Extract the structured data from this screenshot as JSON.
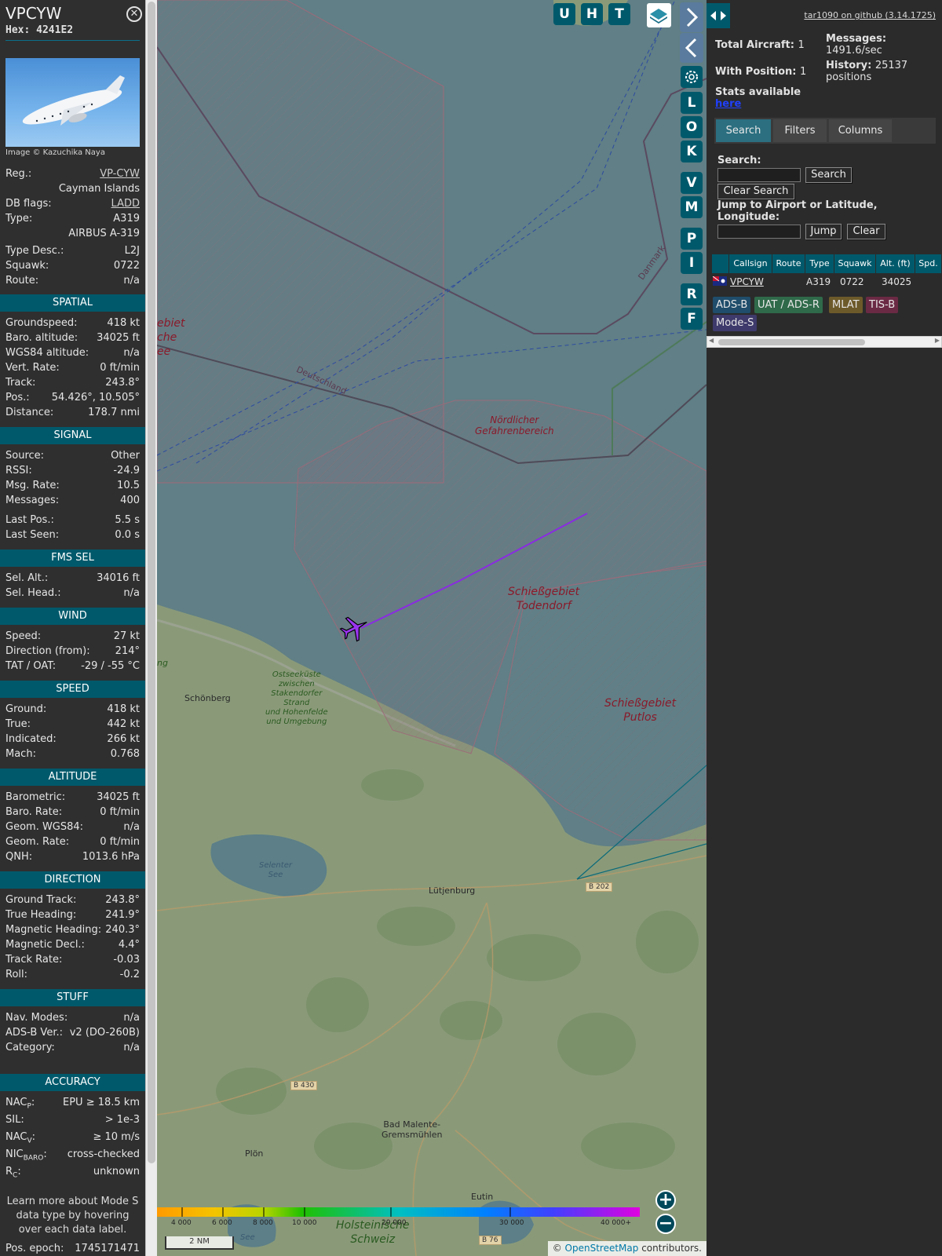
{
  "aircraft": {
    "callsign": "VPCYW",
    "hex_label": "Hex:",
    "hex": "4241E2",
    "photo_credit": "Image © Kazuchika Naya",
    "rows": [
      {
        "k": "Reg.:",
        "v": "VP-CYW",
        "link": true
      },
      {
        "k": "",
        "v": "Cayman Islands"
      },
      {
        "k": "DB flags:",
        "v": "LADD",
        "link": true
      },
      {
        "k": "Type:",
        "v": "A319"
      },
      {
        "k": "",
        "v": "AIRBUS A-319"
      },
      {
        "k": "Type Desc.:",
        "v": "L2J"
      },
      {
        "k": "Squawk:",
        "v": "0722"
      },
      {
        "k": "Route:",
        "v": "n/a"
      }
    ]
  },
  "sections": {
    "spatial": {
      "title": "SPATIAL",
      "rows": [
        {
          "k": "Groundspeed:",
          "v": "418 kt"
        },
        {
          "k": "Baro. altitude:",
          "v": "34025 ft"
        },
        {
          "k": "WGS84 altitude:",
          "v": "n/a"
        },
        {
          "k": "Vert. Rate:",
          "v": "0 ft/min"
        },
        {
          "k": "Track:",
          "v": "243.8°"
        },
        {
          "k": "Pos.:",
          "v": "54.426°, 10.505°"
        },
        {
          "k": "Distance:",
          "v": "178.7 nmi"
        }
      ]
    },
    "signal": {
      "title": "SIGNAL",
      "rows": [
        {
          "k": "Source:",
          "v": "Other"
        },
        {
          "k": "RSSI:",
          "v": "-24.9"
        },
        {
          "k": "Msg. Rate:",
          "v": "10.5"
        },
        {
          "k": "Messages:",
          "v": "400"
        },
        {
          "k": "Last Pos.:",
          "v": "5.5 s"
        },
        {
          "k": "Last Seen:",
          "v": "0.0 s"
        }
      ]
    },
    "fms": {
      "title": "FMS SEL",
      "rows": [
        {
          "k": "Sel. Alt.:",
          "v": "34016 ft"
        },
        {
          "k": "Sel. Head.:",
          "v": "n/a"
        }
      ]
    },
    "wind": {
      "title": "WIND",
      "rows": [
        {
          "k": "Speed:",
          "v": "27 kt"
        },
        {
          "k": "Direction (from):",
          "v": "214°"
        },
        {
          "k": "TAT / OAT:",
          "v": "-29 / -55 °C"
        }
      ]
    },
    "speed": {
      "title": "SPEED",
      "rows": [
        {
          "k": "Ground:",
          "v": "418 kt"
        },
        {
          "k": "True:",
          "v": "442 kt"
        },
        {
          "k": "Indicated:",
          "v": "266 kt"
        },
        {
          "k": "Mach:",
          "v": "0.768"
        }
      ]
    },
    "altitude": {
      "title": "ALTITUDE",
      "rows": [
        {
          "k": "Barometric:",
          "v": "34025 ft"
        },
        {
          "k": "Baro. Rate:",
          "v": "0 ft/min"
        },
        {
          "k": "Geom. WGS84:",
          "v": "n/a"
        },
        {
          "k": "Geom. Rate:",
          "v": "0 ft/min"
        },
        {
          "k": "QNH:",
          "v": "1013.6 hPa"
        }
      ]
    },
    "direction": {
      "title": "DIRECTION",
      "rows": [
        {
          "k": "Ground Track:",
          "v": "243.8°"
        },
        {
          "k": "True Heading:",
          "v": "241.9°"
        },
        {
          "k": "Magnetic Heading:",
          "v": "240.3°"
        },
        {
          "k": "Magnetic Decl.:",
          "v": "4.4°"
        },
        {
          "k": "Track Rate:",
          "v": "-0.03"
        },
        {
          "k": "Roll:",
          "v": "-0.2"
        }
      ]
    },
    "stuff": {
      "title": "STUFF",
      "rows": [
        {
          "k": "Nav. Modes:",
          "v": "n/a"
        },
        {
          "k": "ADS-B Ver.:",
          "v": "v2 (DO-260B)"
        },
        {
          "k": "Category:",
          "v": "n/a"
        }
      ]
    },
    "accuracy": {
      "title": "ACCURACY",
      "rows": [
        {
          "k": "NAC",
          "sub": "P",
          "v": "EPU ≥ 18.5 km"
        },
        {
          "k": "SIL:",
          "v": "> 1e-3"
        },
        {
          "k": "NAC",
          "sub": "V",
          "v": "≥ 10 m/s"
        },
        {
          "k": "NIC",
          "sub": "BARO",
          "v": "cross-checked"
        },
        {
          "k": "R",
          "sub": "C",
          "v": "unknown"
        }
      ]
    }
  },
  "footer_note": "Learn more about Mode S data type by hovering over each data label.",
  "pos_epoch": {
    "k": "Pos. epoch:",
    "v": "1745171471"
  },
  "map": {
    "buttons": [
      "U",
      "H",
      "T"
    ],
    "side_buttons": [
      "L",
      "O",
      "K",
      "V",
      "M",
      "P",
      "I",
      "R",
      "F"
    ],
    "labels": {
      "nordlicher_1": "Nördlicher",
      "nordlicher_2": "Gefahrenbereich",
      "todendorf_1": "Schießgebiet",
      "todendorf_2": "Todendorf",
      "putlos_1": "Schießgebiet",
      "putlos_2": "Putlos",
      "deutschland": "Deutschland",
      "danmark": "Danmark",
      "left_1": "ebiet",
      "left_2": "che",
      "left_3": "ee",
      "schoenberg": "Schönberg",
      "ostsee_1": "Ostseeküste",
      "ostsee_2": "zwischen",
      "ostsee_3": "Stakendorfer",
      "ostsee_4": "Strand",
      "ostsee_5": "und Hohenfelde",
      "ostsee_6": "und Umgebung",
      "selenter_1": "Selenter",
      "selenter_2": "See",
      "lutjenburg": "Lütjenburg",
      "b202": "B 202",
      "b430": "B 430",
      "b76": "B 76",
      "badmalente_1": "Bad Malente-",
      "badmalente_2": "Gremsmühlen",
      "plon": "Plön",
      "eutin": "Eutin",
      "holstein_1": "Holsteinische",
      "holstein_2": "Schweiz",
      "plon_see": "See",
      "ng": "ng"
    },
    "altitude_ticks": [
      "4 000",
      "6 000",
      "8 000",
      "10 000",
      "20 000",
      "30 000",
      "40 000+"
    ],
    "scale": "2 NM",
    "attribution_prefix": "© ",
    "attribution_link": "OpenStreetMap",
    "attribution_suffix": " contributors."
  },
  "right": {
    "github": "tar1090 on github (3.14.1725)",
    "total_aircraft_label": "Total Aircraft:",
    "total_aircraft": "1",
    "with_position_label": "With Position:",
    "with_position": "1",
    "messages_label": "Messages:",
    "messages_rate": "1491.6/sec",
    "history_label": "History:",
    "history_value": "25137",
    "history_unit": "positions",
    "stats_text": "Stats available",
    "stats_link": "here",
    "tabs": [
      "Search",
      "Filters",
      "Columns"
    ],
    "search_label": "Search:",
    "search_button": "Search",
    "clear_search_button": "Clear Search",
    "jump_label": "Jump to Airport or Latitude, Longitude:",
    "jump_button": "Jump",
    "clear_button": "Clear",
    "table_headers": [
      "",
      "Callsign",
      "Route",
      "Type",
      "Squawk",
      "Alt. (ft)",
      "Spd."
    ],
    "table_row": {
      "callsign": "VPCYW",
      "route": "",
      "type": "A319",
      "squawk": "0722",
      "alt": "34025"
    },
    "sources": [
      {
        "label": "ADS-B",
        "color": "#1f4d6b"
      },
      {
        "label": "UAT / ADS-R",
        "color": "#2f6a4a"
      },
      {
        "label": "MLAT",
        "color": "#6d5a2a"
      },
      {
        "label": "TIS-B",
        "color": "#6b2a44"
      },
      {
        "label": "Mode-S",
        "color": "#3e3a6b"
      }
    ]
  },
  "colors": {
    "accent": "#00596b",
    "track": "#8a2be2",
    "aircraft": "#9a35f0"
  }
}
